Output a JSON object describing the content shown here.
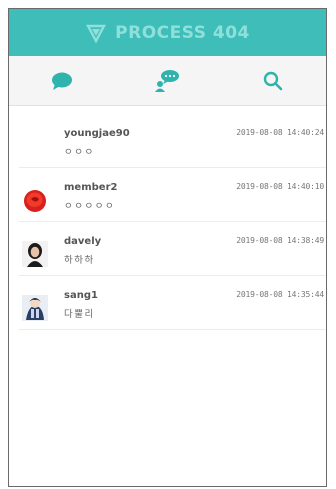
{
  "header": {
    "title": "PROCESS 404",
    "logo_icon": "shield-logo-icon",
    "bg_color": "#3fbdb8"
  },
  "toolbar": {
    "items": [
      {
        "icon": "chat-bubble-icon"
      },
      {
        "icon": "user-chat-icon"
      },
      {
        "icon": "search-icon"
      }
    ],
    "accent_color": "#2fb3ad"
  },
  "conversations": [
    {
      "name": "youngjae90",
      "message": "ㅇㅇㅇ",
      "time": "2019-08-08 14:40:24",
      "avatar": "none"
    },
    {
      "name": "member2",
      "message": "ㅇㅇㅇㅇㅇ",
      "time": "2019-08-08 14:40:10",
      "avatar": "red-flower-avatar"
    },
    {
      "name": "davely",
      "message": "하하하",
      "time": "2019-08-08 14:38:49",
      "avatar": "person-avatar"
    },
    {
      "name": "sang1",
      "message": "다뿔리",
      "time": "2019-08-08 14:35:44",
      "avatar": "character-avatar"
    }
  ]
}
